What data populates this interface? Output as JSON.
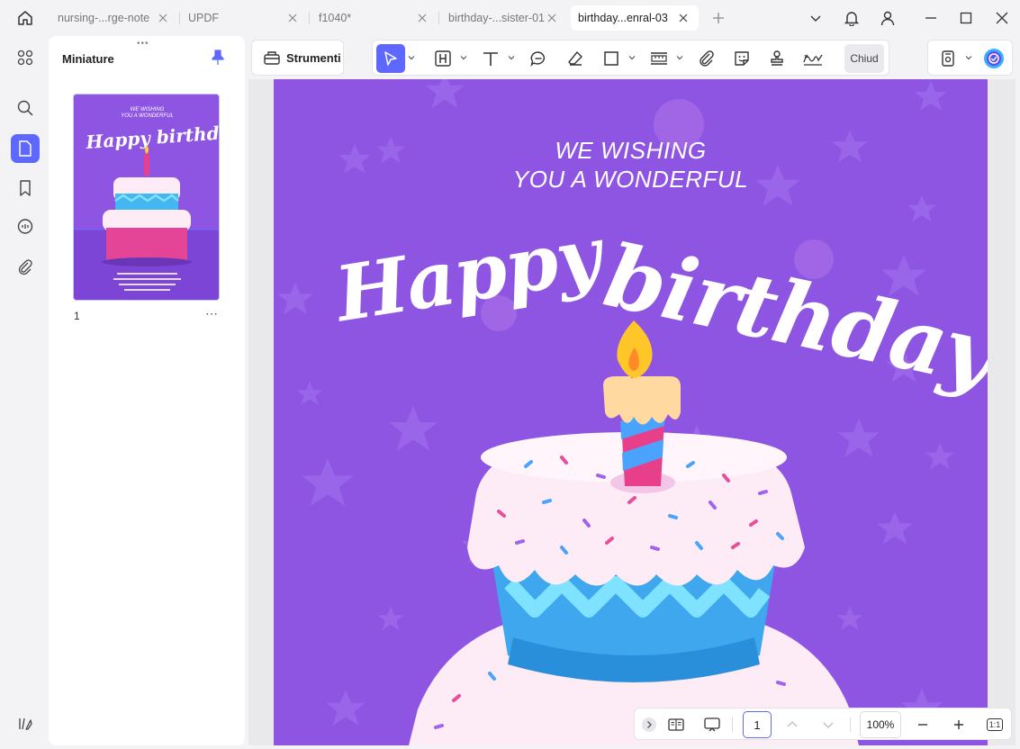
{
  "tabs": [
    {
      "label": "nursing-...rge-note"
    },
    {
      "label": "UPDF"
    },
    {
      "label": "f1040*"
    },
    {
      "label": "birthday-...sister-01"
    },
    {
      "label": "birthday...enral-03",
      "active": true
    }
  ],
  "thumbnails": {
    "title": "Miniature",
    "pages": [
      {
        "number": "1"
      }
    ]
  },
  "toolbar": {
    "tools_label": "Strumenti",
    "close_label": "Chiud"
  },
  "document": {
    "wish_line1": "WE WISHING",
    "wish_line2": "YOU A WONDERFUL",
    "happy": "Happy",
    "birthday": "birthday",
    "thumb_wish1": "WE WISHING",
    "thumb_wish2": "YOU A WONDERFUL",
    "thumb_happy": "Happy birthday"
  },
  "bottombar": {
    "page": "1",
    "zoom": "100%",
    "actual_size": "1:1"
  },
  "colors": {
    "accent": "#5e67ff",
    "page_bg": "#8e55e3",
    "app_bg": "#f3f3f5"
  },
  "icons": {
    "home": "home-icon",
    "bell": "bell-icon",
    "user": "user-icon"
  }
}
